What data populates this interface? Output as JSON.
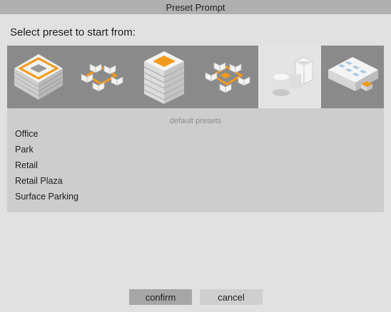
{
  "window": {
    "title": "Preset Prompt"
  },
  "prompt": "Select preset to start from:",
  "presets": [
    {
      "icon": "courtyard-block-icon",
      "selected": false
    },
    {
      "icon": "building-cluster-icon",
      "selected": false
    },
    {
      "icon": "tower-icon",
      "selected": false
    },
    {
      "icon": "campus-cluster-icon",
      "selected": false
    },
    {
      "icon": "tanks-and-building-icon",
      "selected": true
    },
    {
      "icon": "warehouse-icon",
      "selected": false
    }
  ],
  "list": {
    "header": "default presets",
    "items": [
      "Office",
      "Park",
      "Retail",
      "Retail Plaza",
      "Surface Parking"
    ]
  },
  "buttons": {
    "confirm": "confirm",
    "cancel": "cancel"
  },
  "colors": {
    "accent": "#f39a1e",
    "titlebar": "#b0b0b0",
    "strip": "#8a8a8a",
    "panel": "#cdcdcd"
  }
}
